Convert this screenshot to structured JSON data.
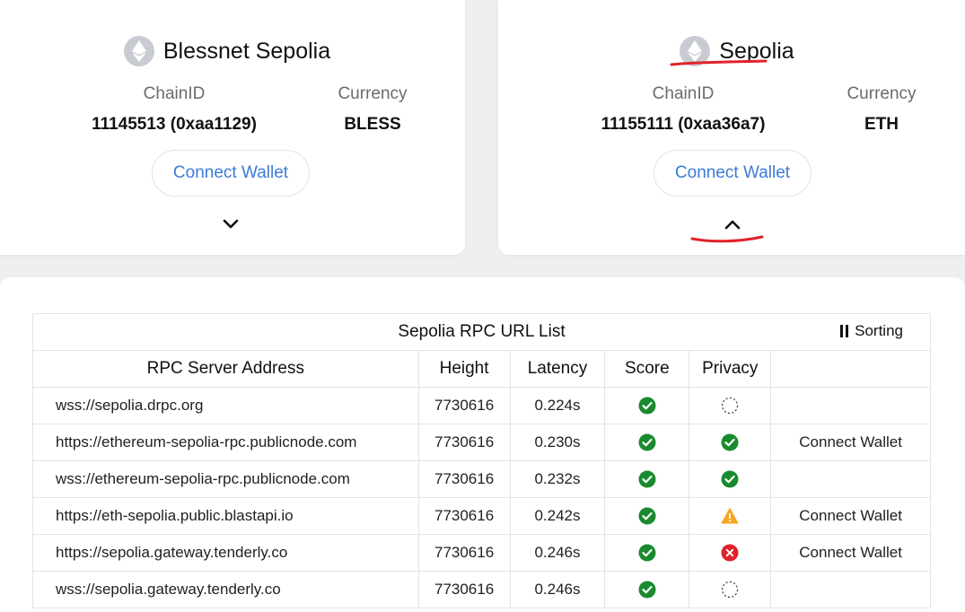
{
  "networks": [
    {
      "name": "Blessnet Sepolia",
      "chainid_label": "ChainID",
      "chainid_value": "11145513 (0xaa1129)",
      "currency_label": "Currency",
      "currency_value": "BLESS",
      "connect_label": "Connect Wallet",
      "expand_icon": "chevron-down-icon"
    },
    {
      "name": "Sepolia",
      "chainid_label": "ChainID",
      "chainid_value": "11155111 (0xaa36a7)",
      "currency_label": "Currency",
      "currency_value": "ETH",
      "connect_label": "Connect Wallet",
      "expand_icon": "chevron-up-icon"
    }
  ],
  "rpc_table": {
    "title": "Sepolia RPC URL List",
    "sort_label": "Sorting",
    "sort_icon": "pause-icon",
    "headers": [
      "RPC Server Address",
      "Height",
      "Latency",
      "Score",
      "Privacy",
      ""
    ],
    "rows": [
      {
        "address": "wss://sepolia.drpc.org",
        "height": "7730616",
        "latency": "0.224s",
        "score": "check",
        "privacy": "unknown",
        "action": ""
      },
      {
        "address": "https://ethereum-sepolia-rpc.publicnode.com",
        "height": "7730616",
        "latency": "0.230s",
        "score": "check",
        "privacy": "check",
        "action": "Connect Wallet"
      },
      {
        "address": "wss://ethereum-sepolia-rpc.publicnode.com",
        "height": "7730616",
        "latency": "0.232s",
        "score": "check",
        "privacy": "check",
        "action": ""
      },
      {
        "address": "https://eth-sepolia.public.blastapi.io",
        "height": "7730616",
        "latency": "0.242s",
        "score": "check",
        "privacy": "warning",
        "action": "Connect Wallet"
      },
      {
        "address": "https://sepolia.gateway.tenderly.co",
        "height": "7730616",
        "latency": "0.246s",
        "score": "check",
        "privacy": "error",
        "action": "Connect Wallet"
      },
      {
        "address": "wss://sepolia.gateway.tenderly.co",
        "height": "7730616",
        "latency": "0.246s",
        "score": "check",
        "privacy": "unknown",
        "action": ""
      }
    ]
  },
  "colors": {
    "accent": "#3b7bd8",
    "success": "#1a8a2e",
    "warning": "#f5a623",
    "error": "#e0222b",
    "annotation": "#e0222b"
  }
}
